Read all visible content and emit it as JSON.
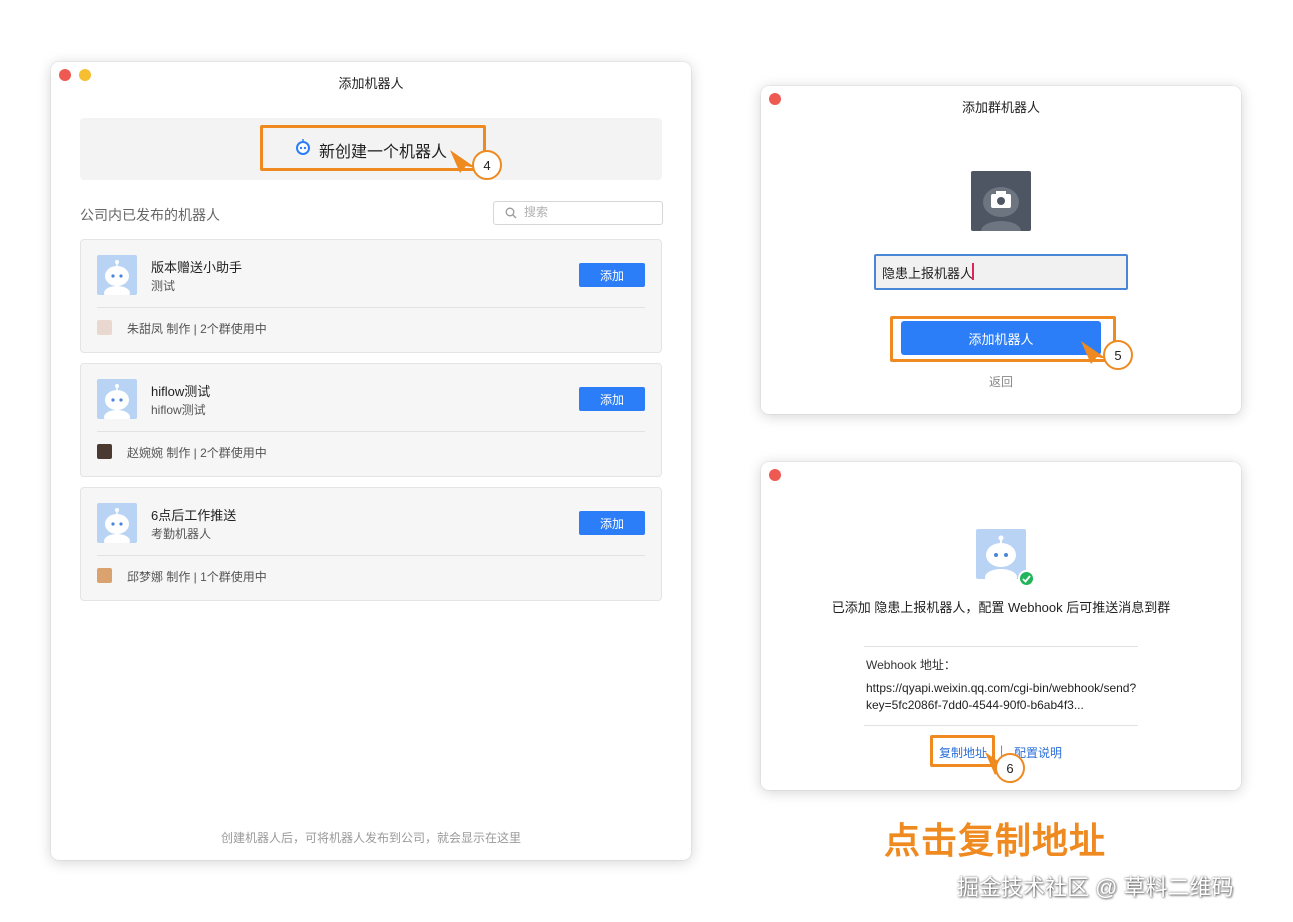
{
  "left_window": {
    "title": "添加机器人",
    "create_button": "新创建一个机器人",
    "step": "4",
    "section_label": "公司内已发布的机器人",
    "search_placeholder": "搜索",
    "robots": [
      {
        "name": "版本赠送小助手",
        "desc": "测试",
        "add": "添加",
        "meta": "朱甜凤 制作 | 2个群使用中"
      },
      {
        "name": "hiflow测试",
        "desc": "hiflow测试",
        "add": "添加",
        "meta": "赵婉婉 制作 | 2个群使用中"
      },
      {
        "name": "6点后工作推送",
        "desc": "考勤机器人",
        "add": "添加",
        "meta": "邱梦娜 制作 | 1个群使用中"
      }
    ],
    "footer": "创建机器人后，可将机器人发布到公司，就会显示在这里"
  },
  "right_top_window": {
    "title": "添加群机器人",
    "name_value": "隐患上报机器人",
    "add_button": "添加机器人",
    "step": "5",
    "back": "返回"
  },
  "right_bottom_window": {
    "success": "已添加 隐患上报机器人，配置 Webhook 后可推送消息到群",
    "webhook_label": "Webhook 地址：",
    "webhook_url": "https://qyapi.weixin.qq.com/cgi-bin/webhook/send?key=5fc2086f-7dd0-4544-90f0-b6ab4f3...",
    "copy_link": "复制地址",
    "separator": "|",
    "config_link": "配置说明",
    "step": "6"
  },
  "caption": "点击复制地址",
  "watermark": "掘金技术社区 @ 草料二维码",
  "colors": {
    "accent": "#2c7ef8",
    "highlight": "#ee8a1f",
    "close": "#ee5a52",
    "minimize": "#f5bf2f",
    "success": "#22b45a"
  }
}
